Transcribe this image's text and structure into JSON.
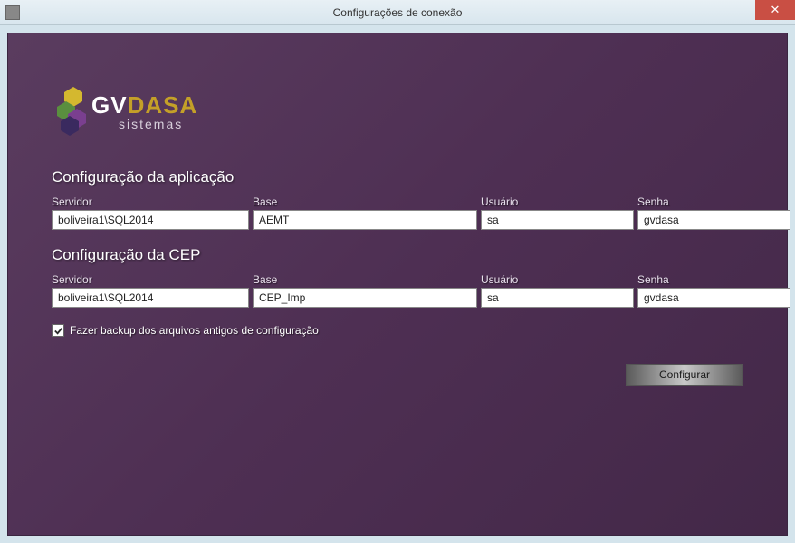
{
  "window": {
    "title": "Configurações de conexão"
  },
  "logo": {
    "main_gv": "GV",
    "main_dasa": "DASA",
    "sub": "sistemas"
  },
  "sections": {
    "app": {
      "title": "Configuração da aplicação",
      "fields": {
        "server_label": "Servidor",
        "server_value": "boliveira1\\SQL2014",
        "base_label": "Base",
        "base_value": "AEMT",
        "user_label": "Usuário",
        "user_value": "sa",
        "pass_label": "Senha",
        "pass_value": "gvdasa"
      }
    },
    "cep": {
      "title": "Configuração da CEP",
      "fields": {
        "server_label": "Servidor",
        "server_value": "boliveira1\\SQL2014",
        "base_label": "Base",
        "base_value": "CEP_Imp",
        "user_label": "Usuário",
        "user_value": "sa",
        "pass_label": "Senha",
        "pass_value": "gvdasa"
      }
    }
  },
  "backup": {
    "checked": true,
    "label": "Fazer backup dos arquivos antigos de configuração"
  },
  "actions": {
    "configure": "Configurar"
  }
}
